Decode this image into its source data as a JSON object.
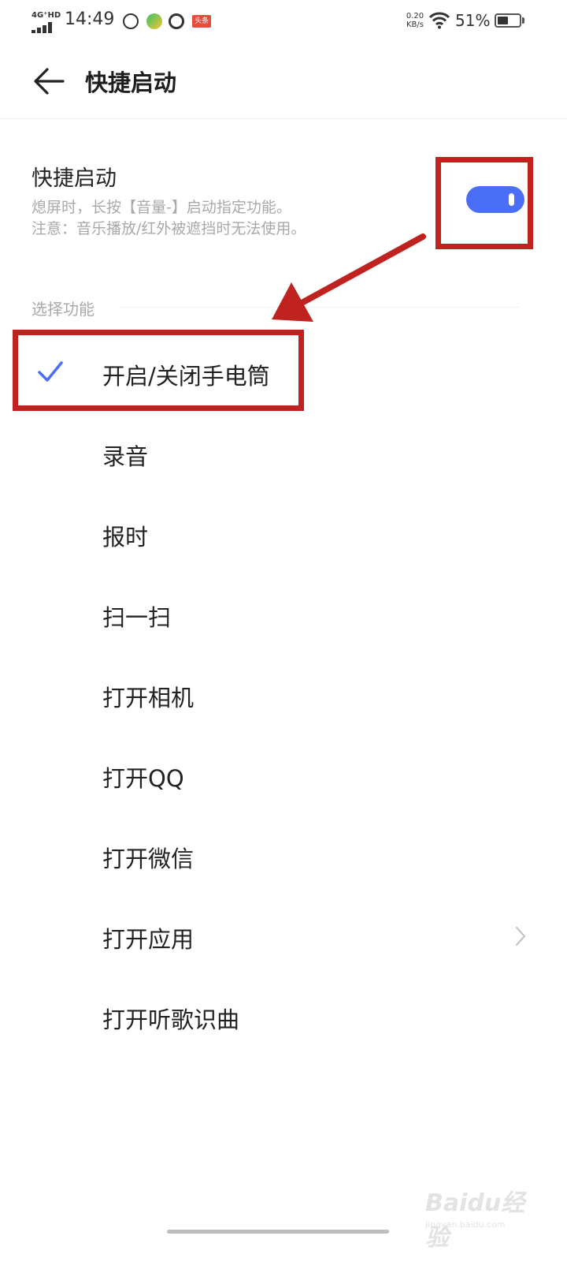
{
  "status_bar": {
    "network": "4G⁺HD",
    "time": "14:49",
    "app_badge": "头条",
    "speed_value": "0.20",
    "speed_unit": "KB/s",
    "battery_percent": "51%",
    "battery_level": 0.51
  },
  "header": {
    "title": "快捷启动"
  },
  "quick_launch": {
    "title": "快捷启动",
    "desc_line1": "熄屏时，长按【音量-】启动指定功能。",
    "desc_line2": "注意：音乐播放/红外被遮挡时无法使用。",
    "enabled": true
  },
  "section": {
    "label": "选择功能"
  },
  "functions": [
    {
      "label": "开启/关闭手电筒",
      "selected": true
    },
    {
      "label": "录音",
      "selected": false
    },
    {
      "label": "报时",
      "selected": false
    },
    {
      "label": "扫一扫",
      "selected": false
    },
    {
      "label": "打开相机",
      "selected": false
    },
    {
      "label": "打开QQ",
      "selected": false
    },
    {
      "label": "打开微信",
      "selected": false
    },
    {
      "label": "打开应用",
      "selected": false,
      "has_submenu": true
    },
    {
      "label": "打开听歌识曲",
      "selected": false
    }
  ],
  "colors": {
    "accent": "#4a6ef5",
    "annotation": "#c0221f"
  },
  "watermark": {
    "logo": "Baidu经验",
    "site": "jingyan.baidu.com"
  }
}
